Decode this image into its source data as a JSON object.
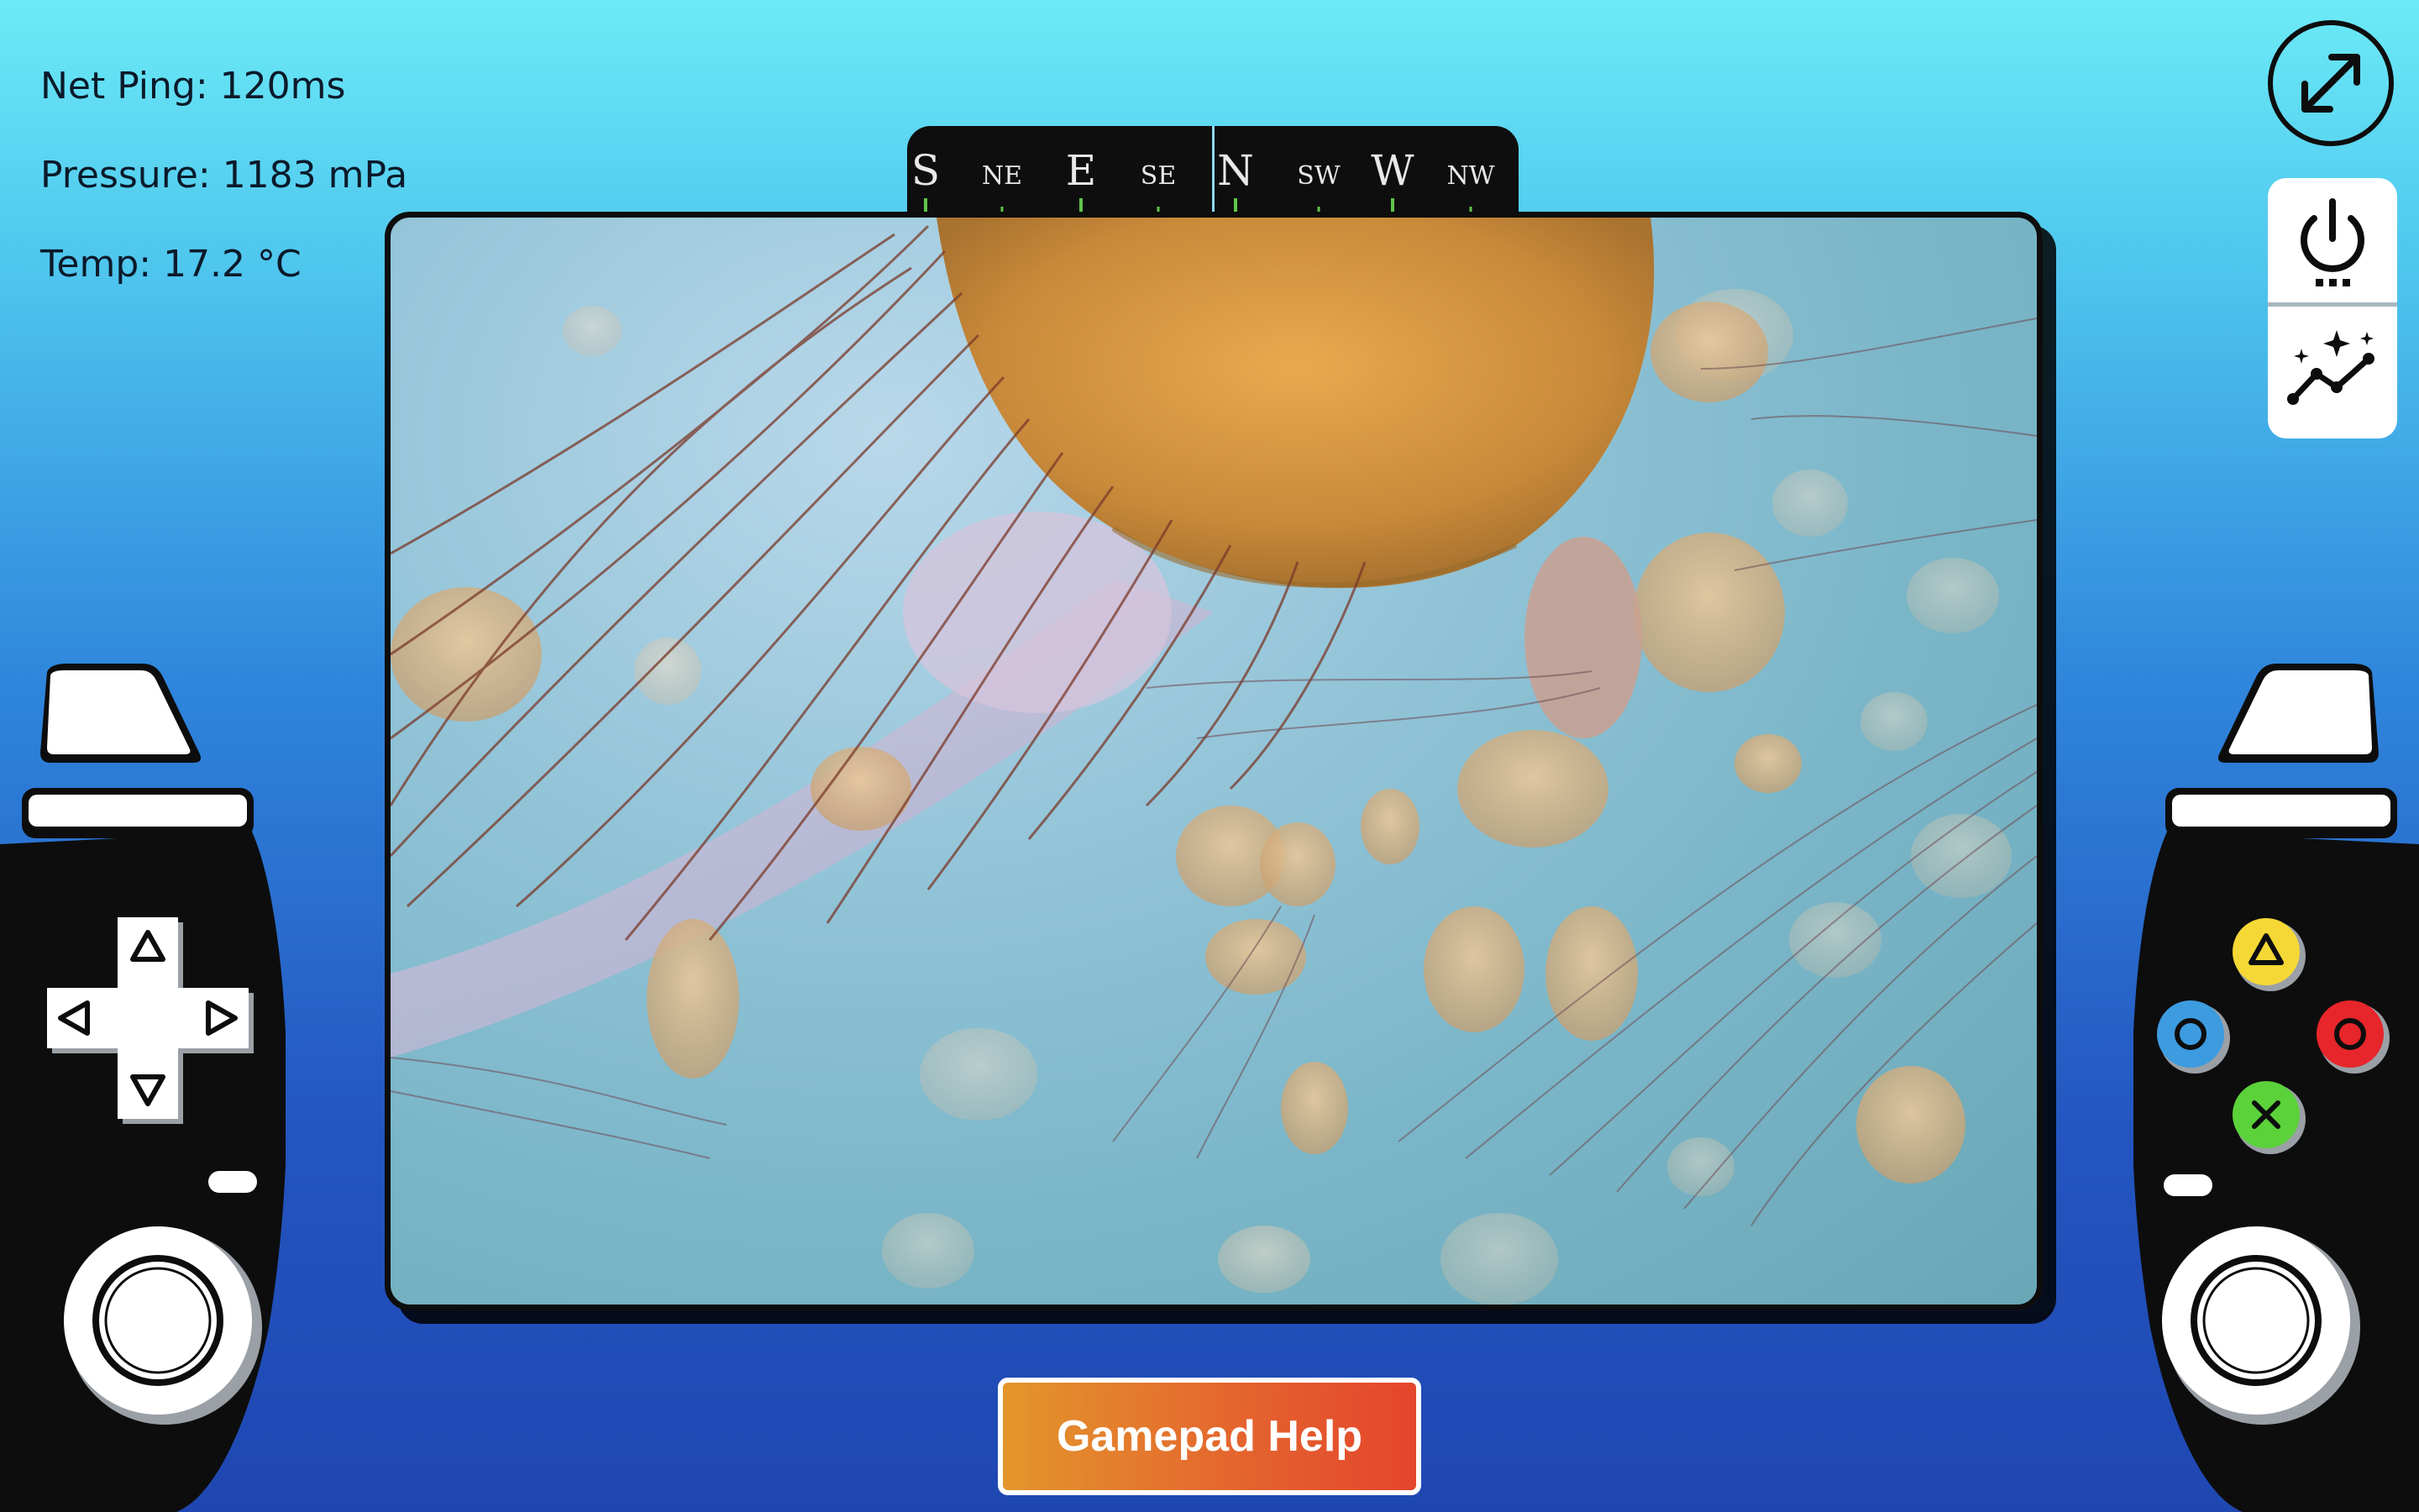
{
  "telemetry": {
    "ping": "Net Ping: 120ms",
    "pressure": "Pressure: 1183 mPa",
    "temp": "Temp: 17.2 °C"
  },
  "compass": {
    "labels": [
      "S",
      "NE",
      "E",
      "SE",
      "N",
      "SW",
      "W",
      "NW"
    ],
    "heading_label": "N"
  },
  "video": {
    "icon": "camera-feed-jellyfish"
  },
  "buttons": {
    "fullscreen_icon": "expand-arrows-icon",
    "power_icon": "power-icon",
    "chart_icon": "sparkle-line-chart-icon",
    "help_label": "Gamepad Help"
  },
  "gamepad": {
    "triangle_color": "#f5d835",
    "circle_color": "#e6262a",
    "square_color": "#3d9be0",
    "cross_color": "#5bd13a"
  },
  "colors": {
    "accent_gradient_start": "#e3962c",
    "accent_gradient_end": "#e4452c",
    "bg_top": "#6ceaf6",
    "bg_bottom": "#1f47b2"
  }
}
